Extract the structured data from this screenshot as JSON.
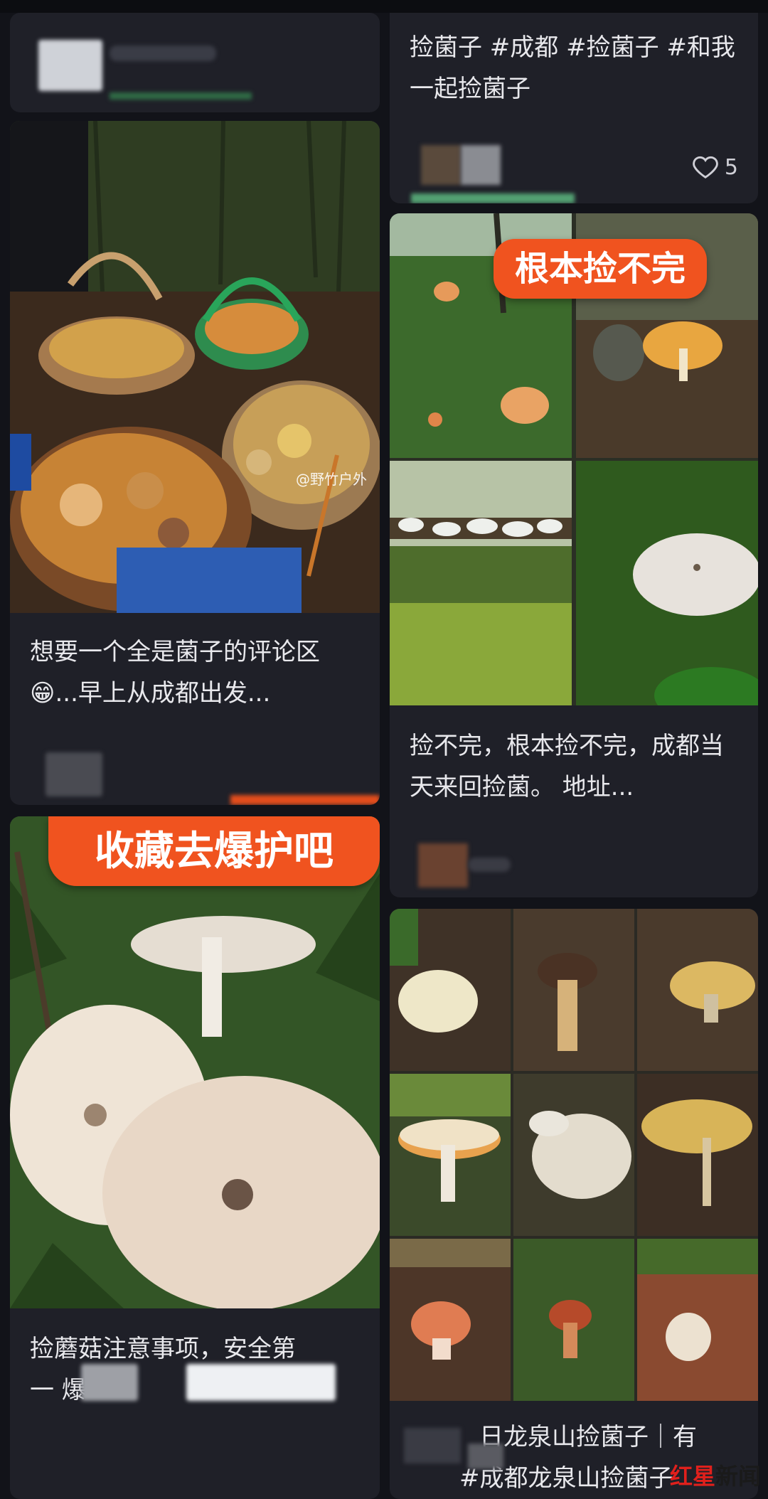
{
  "feed": {
    "left": {
      "card_top": {
        "text_obscured": true
      },
      "card_baskets": {
        "image_watermark": "@野竹户外",
        "text_prefix": "想要一个全是菌子的评论区",
        "emoji": "😁",
        "text_suffix": "...早上从成都出发..."
      },
      "card_pale": {
        "banner": "收藏去爆护吧",
        "text_line1": "捡蘑菇注意事项，安全第",
        "text_line2_start": "一 爆"
      }
    },
    "right": {
      "card_top": {
        "text": "捡菌子 #成都 #捡菌子 #和我一起捡菌子",
        "likes": "5"
      },
      "card_grid4": {
        "banner": "根本捡不完",
        "text": "捡不完，根本捡不完，成都当天来回捡菌。 地址..."
      },
      "card_grid9": {
        "text_line1": "日龙泉山捡菌子｜有",
        "text_line2": "#成都龙泉山捡菌子"
      }
    }
  },
  "watermark": {
    "red": "红星",
    "black": "新闻"
  },
  "colors": {
    "background": "#121319",
    "card": "#1f2028",
    "banner": "#f0531f"
  }
}
